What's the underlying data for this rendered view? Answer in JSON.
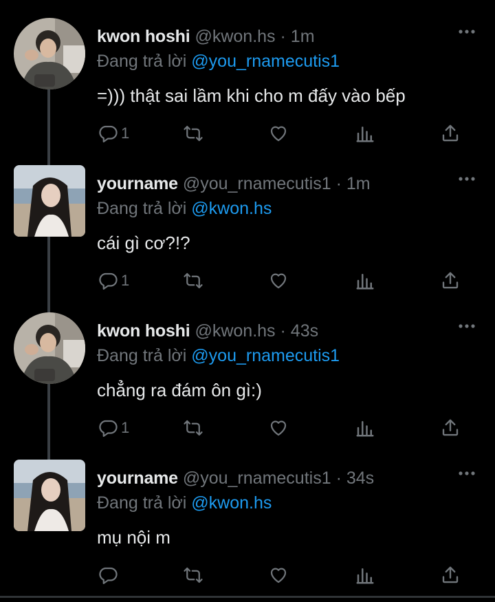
{
  "colors": {
    "background": "#000000",
    "text": "#e7e9ea",
    "muted": "#71767b",
    "link": "#1d9bf0",
    "thread": "#3a3f44"
  },
  "icons": {
    "more": "more-dots-icon",
    "reply": "reply-bubble-icon",
    "retweet": "retweet-icon",
    "like": "heart-icon",
    "analytics": "analytics-bars-icon",
    "share": "share-icon"
  },
  "tweets": [
    {
      "name": "kwon hoshi",
      "handle": "@kwon.hs",
      "separator": "·",
      "time": "1m",
      "reply_prefix": "Đang trả lời",
      "reply_to": "@you_rnamecutis1",
      "text": "=))) thật sai lầm khi cho m đấy vào bếp",
      "reply_count": "1"
    },
    {
      "name": "yourname",
      "handle": "@you_rnamecutis1",
      "separator": "·",
      "time": "1m",
      "reply_prefix": "Đang trả lời",
      "reply_to": "@kwon.hs",
      "text": "cái gì cơ?!?",
      "reply_count": "1"
    },
    {
      "name": "kwon hoshi",
      "handle": "@kwon.hs",
      "separator": "·",
      "time": "43s",
      "reply_prefix": "Đang trả lời",
      "reply_to": "@you_rnamecutis1",
      "text": "chẳng ra đám ôn gì:)",
      "reply_count": "1"
    },
    {
      "name": "yourname",
      "handle": "@you_rnamecutis1",
      "separator": "·",
      "time": "34s",
      "reply_prefix": "Đang trả lời",
      "reply_to": "@kwon.hs",
      "text": "mụ nội m",
      "reply_count": ""
    }
  ]
}
